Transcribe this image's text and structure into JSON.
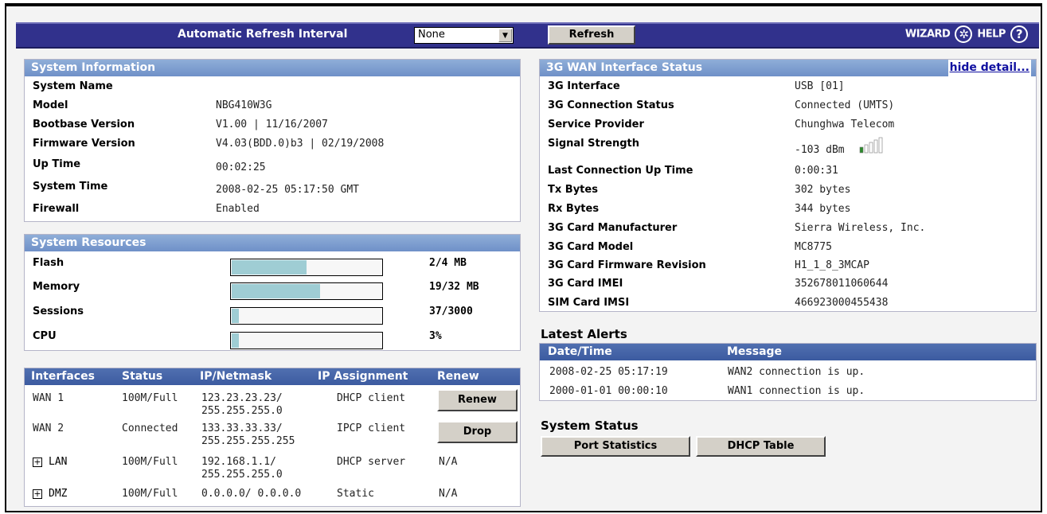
{
  "toolbar": {
    "refresh_interval_label": "Automatic Refresh Interval",
    "refresh_interval_value": "None",
    "refresh_button": "Refresh",
    "wizard_label": "WIZARD",
    "help_label": "HELP"
  },
  "system_info": {
    "title": "System Information",
    "rows": [
      {
        "key": "System Name",
        "value": ""
      },
      {
        "key": "Model",
        "value": "NBG410W3G"
      },
      {
        "key": "Bootbase Version",
        "value": "V1.00 | 11/16/2007"
      },
      {
        "key": "Firmware Version",
        "value": "V4.03(BDD.0)b3 | 02/19/2008"
      },
      {
        "key": "Up Time",
        "value": "00:02:25"
      },
      {
        "key": "System Time",
        "value": "2008-02-25 05:17:50 GMT"
      },
      {
        "key": "Firewall",
        "value": "Enabled"
      }
    ]
  },
  "system_resources": {
    "title": "System Resources",
    "items": [
      {
        "label": "Flash",
        "value": "2/4 MB",
        "fraction": 0.5
      },
      {
        "label": "Memory",
        "value": "19/32 MB",
        "fraction": 0.59
      },
      {
        "label": "Sessions",
        "value": "37/3000",
        "fraction": 0.05
      },
      {
        "label": "CPU",
        "value": "3%",
        "fraction": 0.05
      }
    ]
  },
  "interfaces": {
    "headers": [
      "Interfaces",
      "Status",
      "IP/Netmask",
      "IP Assignment",
      "Renew"
    ],
    "rows": [
      {
        "name": "WAN 1",
        "status": "100M/Full",
        "ip": "123.23.23.23/",
        "mask": "255.255.255.0",
        "assign": "DHCP client",
        "renew": "Renew"
      },
      {
        "name": "WAN 2",
        "status": "Connected",
        "ip": "133.33.33.33/",
        "mask": "255.255.255.255",
        "assign": "IPCP client",
        "renew": "Drop"
      },
      {
        "name": "LAN",
        "status": "100M/Full",
        "ip": "192.168.1.1/",
        "mask": "255.255.255.0",
        "assign": "DHCP server",
        "renew": "N/A"
      },
      {
        "name": "DMZ",
        "status": "100M/Full",
        "ip": "0.0.0.0/ 0.0.0.0",
        "mask": "",
        "assign": "Static",
        "renew": "N/A"
      }
    ]
  },
  "wan3g": {
    "title": "3G WAN Interface Status",
    "hide_detail": "hide detail...",
    "rows": [
      {
        "key": "3G Interface",
        "value": "USB [01]"
      },
      {
        "key": "3G Connection Status",
        "value": "Connected (UMTS)"
      },
      {
        "key": "Service Provider",
        "value": "Chunghwa Telecom"
      },
      {
        "key": "Signal Strength",
        "value": "-103 dBm"
      },
      {
        "key": "Last Connection Up Time",
        "value": "0:00:31"
      },
      {
        "key": "Tx Bytes",
        "value": "302 bytes"
      },
      {
        "key": "Rx Bytes",
        "value": "344 bytes"
      },
      {
        "key": "3G Card Manufacturer",
        "value": "Sierra Wireless, Inc."
      },
      {
        "key": "3G Card Model",
        "value": "MC8775"
      },
      {
        "key": "3G Card Firmware Revision",
        "value": "H1_1_8_3MCAP"
      },
      {
        "key": "3G Card IMEI",
        "value": "352678011060644"
      },
      {
        "key": "SIM Card IMSI",
        "value": "466923000455438"
      }
    ]
  },
  "alerts": {
    "title": "Latest Alerts",
    "headers": [
      "Date/Time",
      "Message"
    ],
    "rows": [
      {
        "time": "2008-02-25 05:17:19",
        "message": "WAN2 connection is up."
      },
      {
        "time": "2000-01-01 00:00:10",
        "message": "WAN1 connection is up."
      }
    ]
  },
  "system_status": {
    "title": "System Status",
    "port_statistics": "Port Statistics",
    "dhcp_table": "DHCP Table"
  },
  "colors": {
    "topbar": "#31318c",
    "bar_fill": "#9fcdd4",
    "panel_header": "#7b9bd0"
  }
}
